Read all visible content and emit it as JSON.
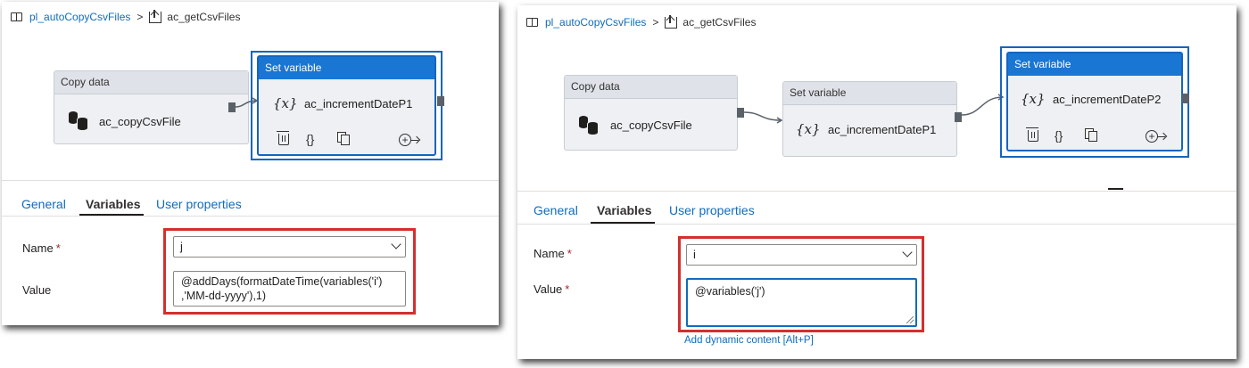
{
  "left": {
    "breadcrumb": {
      "pipeline": "pl_autoCopyCsvFiles",
      "separator": ">",
      "activity": "ac_getCsvFiles"
    },
    "nodes": {
      "copy": {
        "type": "Copy data",
        "name": "ac_copyCsvFile"
      },
      "setvar": {
        "type": "Set variable",
        "name": "ac_incrementDateP1",
        "icon": "{x}"
      }
    },
    "actions": {
      "code": "{}"
    },
    "tabs": [
      "General",
      "Variables",
      "User properties"
    ],
    "form": {
      "name_label": "Name",
      "name_required": "*",
      "name_value": "j",
      "value_label": "Value",
      "value_line1": "@addDays(formatDateTime(variables('i')",
      "value_line2": ",'MM-dd-yyyy'),1)"
    }
  },
  "right": {
    "breadcrumb": {
      "pipeline": "pl_autoCopyCsvFiles",
      "separator": ">",
      "activity": "ac_getCsvFiles"
    },
    "nodes": {
      "copy": {
        "type": "Copy data",
        "name": "ac_copyCsvFile"
      },
      "setvar1": {
        "type": "Set variable",
        "name": "ac_incrementDateP1",
        "icon": "{x}"
      },
      "setvar2": {
        "type": "Set variable",
        "name": "ac_incrementDateP2",
        "icon": "{x}"
      }
    },
    "actions": {
      "code": "{}"
    },
    "tabs": [
      "General",
      "Variables",
      "User properties"
    ],
    "form": {
      "name_label": "Name",
      "name_required": "*",
      "name_value": "i",
      "value_label": "Value",
      "value_required": "*",
      "value_text": "@variables('j')",
      "dynamic_link": "Add dynamic content [Alt+P]"
    }
  },
  "colors": {
    "selection_blue": "#1565c0",
    "highlight_red": "#d32f2f",
    "link_blue": "#0f6cbd"
  }
}
